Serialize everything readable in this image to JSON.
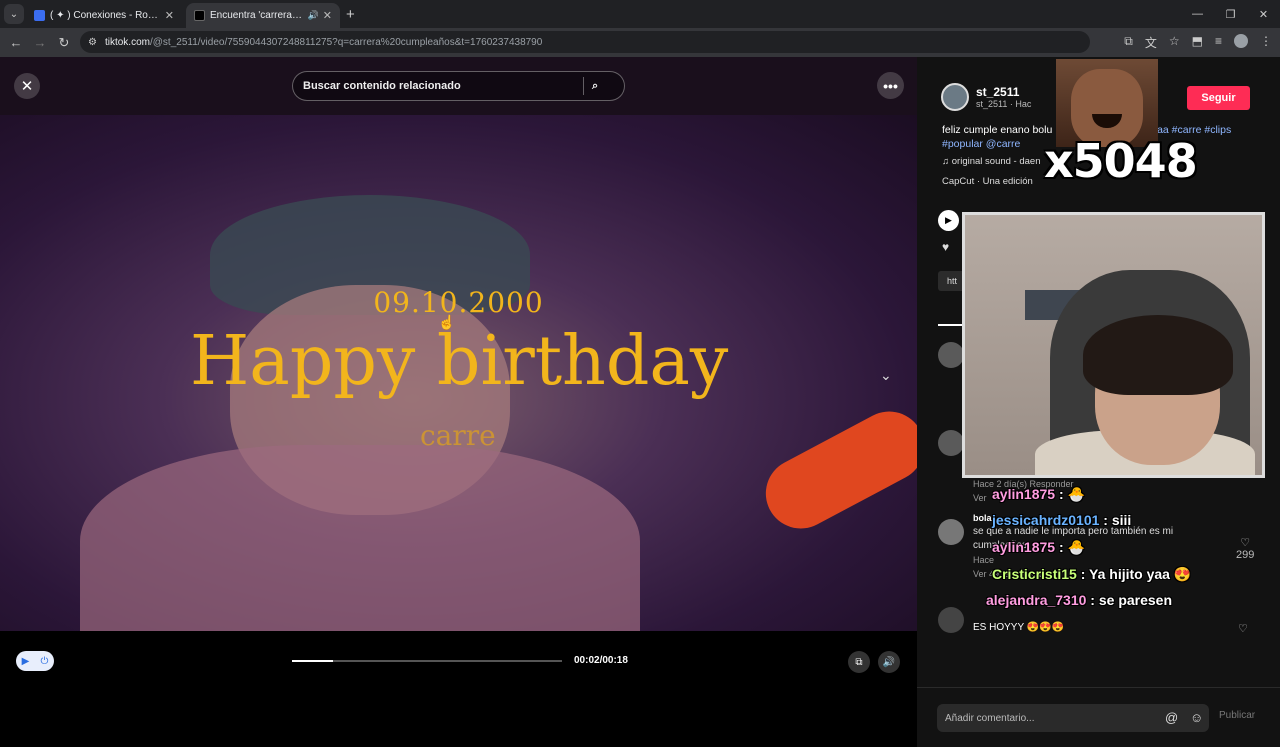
{
  "browser": {
    "tab_menu_icon": "chevron-down-icon",
    "tabs": [
      {
        "title": "( ✦ ) Conexiones - Roblox",
        "favicon": "roblox-icon"
      },
      {
        "title": "Encuentra 'carrera cumpleaños",
        "favicon": "tiktok-icon"
      }
    ],
    "new_tab": "+",
    "url_host": "tiktok.com",
    "url_path": "/@st_2511/video/7559044307248811275?q=carrera%20cumpleaños&t=1760237438790"
  },
  "player": {
    "search_placeholder": "Buscar contenido relacionado",
    "overlay_date": "09.10.2000",
    "overlay_title": "Happy birthday",
    "overlay_name": "carre",
    "time": "00:02/00:18",
    "progress": 0.15
  },
  "sidebar": {
    "author_name": "st_2511",
    "author_sub": "st_2511 · Hac",
    "follow_label": "Seguir",
    "desc_text": "feliz cumple enano bolu",
    "desc_tags_line1": "aaa #carre #clips",
    "desc_tags_line2a": "#popular",
    "desc_tags_line2b": "@carre",
    "sound": "♫  original sound - daen",
    "capcut": "CapCut · Una edición",
    "link_chip": "htt",
    "comment_meta1": "Hace 2 día(s)     Responder",
    "comment_meta2": "Ver",
    "comment_user": "bola",
    "comment_text1": "se que a nadie le importa pero también es mi",
    "comment_text2": "cumpleaños",
    "comment_meta3": "Hace",
    "comment_meta4": "Ver 49 respuestas",
    "likes_count": "299",
    "last_comment": "ES HOYYY 😍😍😍",
    "comment_placeholder": "Añadir comentario...",
    "publish_label": "Publicar"
  },
  "overlays": {
    "multiplier": "x5048",
    "chat": [
      {
        "user": "aylin1875",
        "sep": " : ",
        "msg": "🐣"
      },
      {
        "user": "jessicahrdz0101",
        "sep": " : ",
        "msg": "siii"
      },
      {
        "user": "aylin1875",
        "sep": " : ",
        "msg": "🐣"
      },
      {
        "user": "Cristicristi15",
        "sep": " : ",
        "msg": "Ya hijito yaa 😍"
      },
      {
        "user": "alejandra_7310",
        "sep": " : ",
        "msg": "se paresen"
      }
    ]
  },
  "colors": {
    "accent": "#fe2c55",
    "overlay_text": "#f2b51c",
    "tag_link": "#8fb6ff"
  }
}
